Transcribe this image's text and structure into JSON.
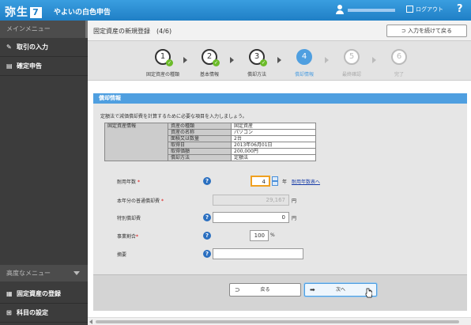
{
  "app": {
    "logo_text": "弥生",
    "logo_mark": "7",
    "name": "やよいの白色申告",
    "logout_label": "ログアウト",
    "help_label": "?"
  },
  "sidebar": {
    "header": "メインメニュー",
    "items": [
      {
        "label": "取引の入力",
        "icon": "pencil-icon"
      },
      {
        "label": "確定申告",
        "icon": "document-icon"
      }
    ],
    "advanced_header": "高度なメニュー",
    "bottom_items": [
      {
        "label": "固定資産の登録",
        "icon": "building-icon"
      },
      {
        "label": "科目の設定",
        "icon": "tree-icon"
      }
    ]
  },
  "header": {
    "title": "固定資産の新規登録　(4/6)",
    "back_button": "入力を続けて戻る"
  },
  "steps": [
    {
      "number": "1",
      "label": "固定資産の種類",
      "state": "done"
    },
    {
      "number": "2",
      "label": "基本情報",
      "state": "done"
    },
    {
      "number": "3",
      "label": "償却方法",
      "state": "done"
    },
    {
      "number": "4",
      "label": "償却情報",
      "state": "current"
    },
    {
      "number": "5",
      "label": "最終確認",
      "state": "future"
    },
    {
      "number": "6",
      "label": "完了",
      "state": "future"
    }
  ],
  "panel": {
    "title": "償却情報",
    "description": "定額法で減価償却費を計算するために必要な項目を入力しましょう。",
    "info_group_label": "固定資産情報",
    "info_rows": [
      {
        "label": "資産の種類",
        "value": "固定資産"
      },
      {
        "label": "資産の名称",
        "value": "パソコン"
      },
      {
        "label": "面積又は数量",
        "value": "2台"
      },
      {
        "label": "取得日",
        "value": "2013年06月01日"
      },
      {
        "label": "取得価額",
        "value": "200,000円"
      },
      {
        "label": "償却方法",
        "value": "定額法"
      }
    ]
  },
  "form": {
    "useful_life": {
      "label": "耐用年数",
      "value": "4",
      "unit": "年",
      "link": "耐用年数表へ"
    },
    "normal_depreciation": {
      "label": "本年分の普通償却費",
      "value": "29,167",
      "unit": "円"
    },
    "special_depreciation": {
      "label": "特別償却費",
      "value": "0",
      "unit": "円"
    },
    "business_ratio": {
      "label": "事業割合",
      "value": "100",
      "unit": "%"
    },
    "memo": {
      "label": "摘要",
      "value": ""
    }
  },
  "buttons": {
    "back": "戻る",
    "next": "次へ"
  },
  "colors": {
    "accent": "#4f9fe0",
    "topbar": "#1f7fc6",
    "sidebar": "#3c3c3c",
    "check": "#6cbb2a",
    "required": "#dd0000"
  }
}
